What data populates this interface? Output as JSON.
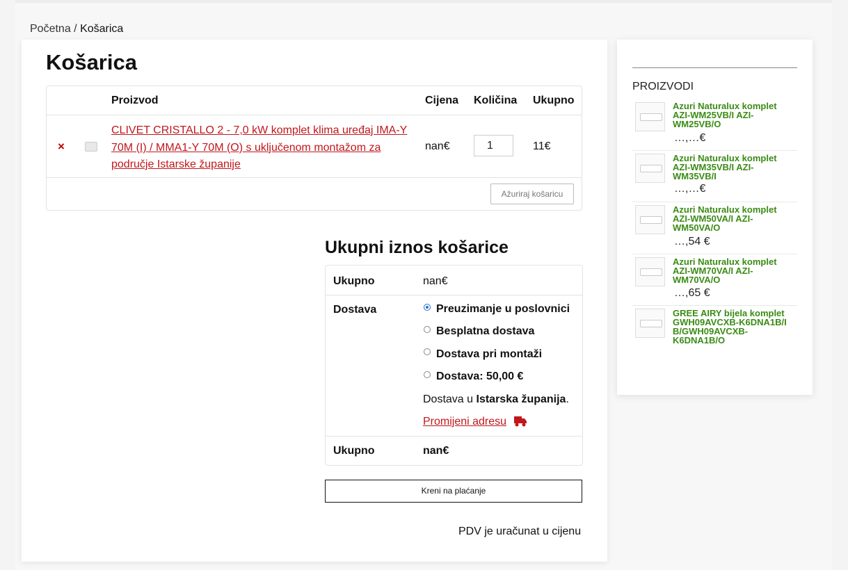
{
  "breadcrumb": {
    "home": "Početna",
    "separator": " / ",
    "current": "Košarica"
  },
  "cart": {
    "title": "Košarica",
    "headers": {
      "product": "Proizvod",
      "price": "Cijena",
      "quantity": "Količina",
      "total": "Ukupno"
    },
    "items": [
      {
        "remove": "×",
        "name": "CLIVET CRISTALLO 2 - 7,0 kW komplet klima uređaj IMA-Y 70M (I) / MMA1-Y 70M (O) s uključenom montažom za područje Istarske županije",
        "price": "nan€",
        "quantity": "1",
        "subtotal": "11€"
      }
    ],
    "update_button": "Ažuriraj košaricu"
  },
  "totals": {
    "title": "Ukupni iznos košarice",
    "subtotal_label": "Ukupno",
    "subtotal_value": "nan€",
    "shipping_label": "Dostava",
    "shipping_options": [
      {
        "label": "Preuzimanje u poslovnici",
        "selected": true
      },
      {
        "label": "Besplatna dostava",
        "selected": false
      },
      {
        "label": "Dostava pri montaži",
        "selected": false
      },
      {
        "label": "Dostava: 50,00 €",
        "selected": false
      }
    ],
    "shipping_dest_prefix": "Dostava u",
    "shipping_dest_region": "Istarska županija",
    "shipping_dest_suffix": ".",
    "change_address": "Promijeni adresu",
    "total_label": "Ukupno",
    "total_value": "nan€"
  },
  "checkout_button": "Kreni na plaćanje",
  "vat_note": "PDV je uračunat u cijenu",
  "sidebar": {
    "title": "PROIZVODI",
    "products": [
      {
        "name": "Azuri Naturalux komplet AZI-WM25VB/I AZI-WM25VB/O",
        "price": "…,…€"
      },
      {
        "name": "Azuri Naturalux komplet AZI-WM35VB/I AZI-WM35VB/I",
        "price": "…,…€"
      },
      {
        "name": "Azuri Naturalux komplet AZI-WM50VA/I AZI-WM50VA/O",
        "price": "…,54 €"
      },
      {
        "name": "Azuri Naturalux komplet AZI-WM70VA/I AZI-WM70VA/O",
        "price": "…,65 €"
      },
      {
        "name": "GREE AIRY bijela komplet GWH09AVCXB-K6DNA1B/I B/GWH09AVCXB-K6DNA1B/O",
        "price": ""
      }
    ]
  },
  "colors": {
    "accent_red": "#c0171c",
    "product_green": "#3a8b14",
    "radio_blue": "#2a6fd6"
  }
}
